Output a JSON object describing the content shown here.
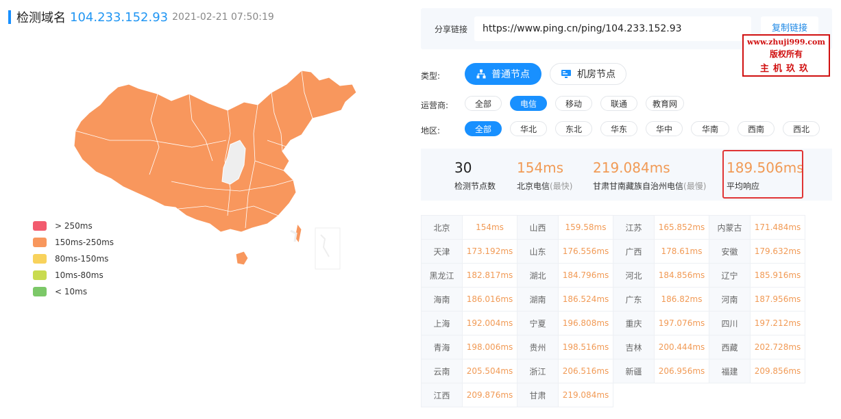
{
  "header": {
    "title": "检测域名",
    "domain": "104.233.152.93",
    "time": "2021-02-21 07:50:19"
  },
  "legend": [
    {
      "label": "> 250ms",
      "color": "#f25b6e"
    },
    {
      "label": "150ms-250ms",
      "color": "#f8975d"
    },
    {
      "label": "80ms-150ms",
      "color": "#f8d25c"
    },
    {
      "label": "10ms-80ms",
      "color": "#c9db4f"
    },
    {
      "label": "< 10ms",
      "color": "#7cc868"
    }
  ],
  "share": {
    "label": "分享链接",
    "url": "https://www.ping.cn/ping/104.233.152.93",
    "copy_label": "复制链接"
  },
  "watermark": {
    "line1": "www.zhuji999.com",
    "line2": "版权所有",
    "line3": "主机玖玖"
  },
  "type": {
    "label": "类型:",
    "options": [
      "普通节点",
      "机房节点"
    ],
    "selected": "普通节点"
  },
  "carrier": {
    "label": "运营商:",
    "options": [
      "全部",
      "电信",
      "移动",
      "联通",
      "教育网"
    ],
    "selected": "电信"
  },
  "region": {
    "label": "地区:",
    "options": [
      "全部",
      "华北",
      "东北",
      "华东",
      "华中",
      "华南",
      "西南",
      "西北"
    ],
    "selected": "全部"
  },
  "stats": {
    "node_count": "30",
    "node_count_label": "检测节点数",
    "fastest_value": "154ms",
    "fastest_label": "北京电信",
    "fastest_tag": "(最快)",
    "slowest_value": "219.084ms",
    "slowest_label": "甘肃甘南藏族自治州电信",
    "slowest_tag": "(最慢)",
    "avg_value": "189.506ms",
    "avg_label": "平均响应"
  },
  "results": [
    {
      "name": "北京",
      "ms": "154ms"
    },
    {
      "name": "山西",
      "ms": "159.58ms"
    },
    {
      "name": "江苏",
      "ms": "165.852ms"
    },
    {
      "name": "内蒙古",
      "ms": "171.484ms"
    },
    {
      "name": "天津",
      "ms": "173.192ms"
    },
    {
      "name": "山东",
      "ms": "176.556ms"
    },
    {
      "name": "广西",
      "ms": "178.61ms"
    },
    {
      "name": "安徽",
      "ms": "179.632ms"
    },
    {
      "name": "黑龙江",
      "ms": "182.817ms"
    },
    {
      "name": "湖北",
      "ms": "184.796ms"
    },
    {
      "name": "河北",
      "ms": "184.856ms"
    },
    {
      "name": "辽宁",
      "ms": "185.916ms"
    },
    {
      "name": "海南",
      "ms": "186.016ms"
    },
    {
      "name": "湖南",
      "ms": "186.524ms"
    },
    {
      "name": "广东",
      "ms": "186.82ms"
    },
    {
      "name": "河南",
      "ms": "187.956ms"
    },
    {
      "name": "上海",
      "ms": "192.004ms"
    },
    {
      "name": "宁夏",
      "ms": "196.808ms"
    },
    {
      "name": "重庆",
      "ms": "197.076ms"
    },
    {
      "name": "四川",
      "ms": "197.212ms"
    },
    {
      "name": "青海",
      "ms": "198.006ms"
    },
    {
      "name": "贵州",
      "ms": "198.516ms"
    },
    {
      "name": "吉林",
      "ms": "200.444ms"
    },
    {
      "name": "西藏",
      "ms": "202.728ms"
    },
    {
      "name": "云南",
      "ms": "205.504ms"
    },
    {
      "name": "浙江",
      "ms": "206.516ms"
    },
    {
      "name": "新疆",
      "ms": "206.956ms"
    },
    {
      "name": "福建",
      "ms": "209.856ms"
    },
    {
      "name": "江西",
      "ms": "209.876ms"
    },
    {
      "name": "甘肃",
      "ms": "219.084ms"
    }
  ],
  "map": {
    "fill_color": "#f8975d",
    "nodata_color": "#eeeeee"
  }
}
